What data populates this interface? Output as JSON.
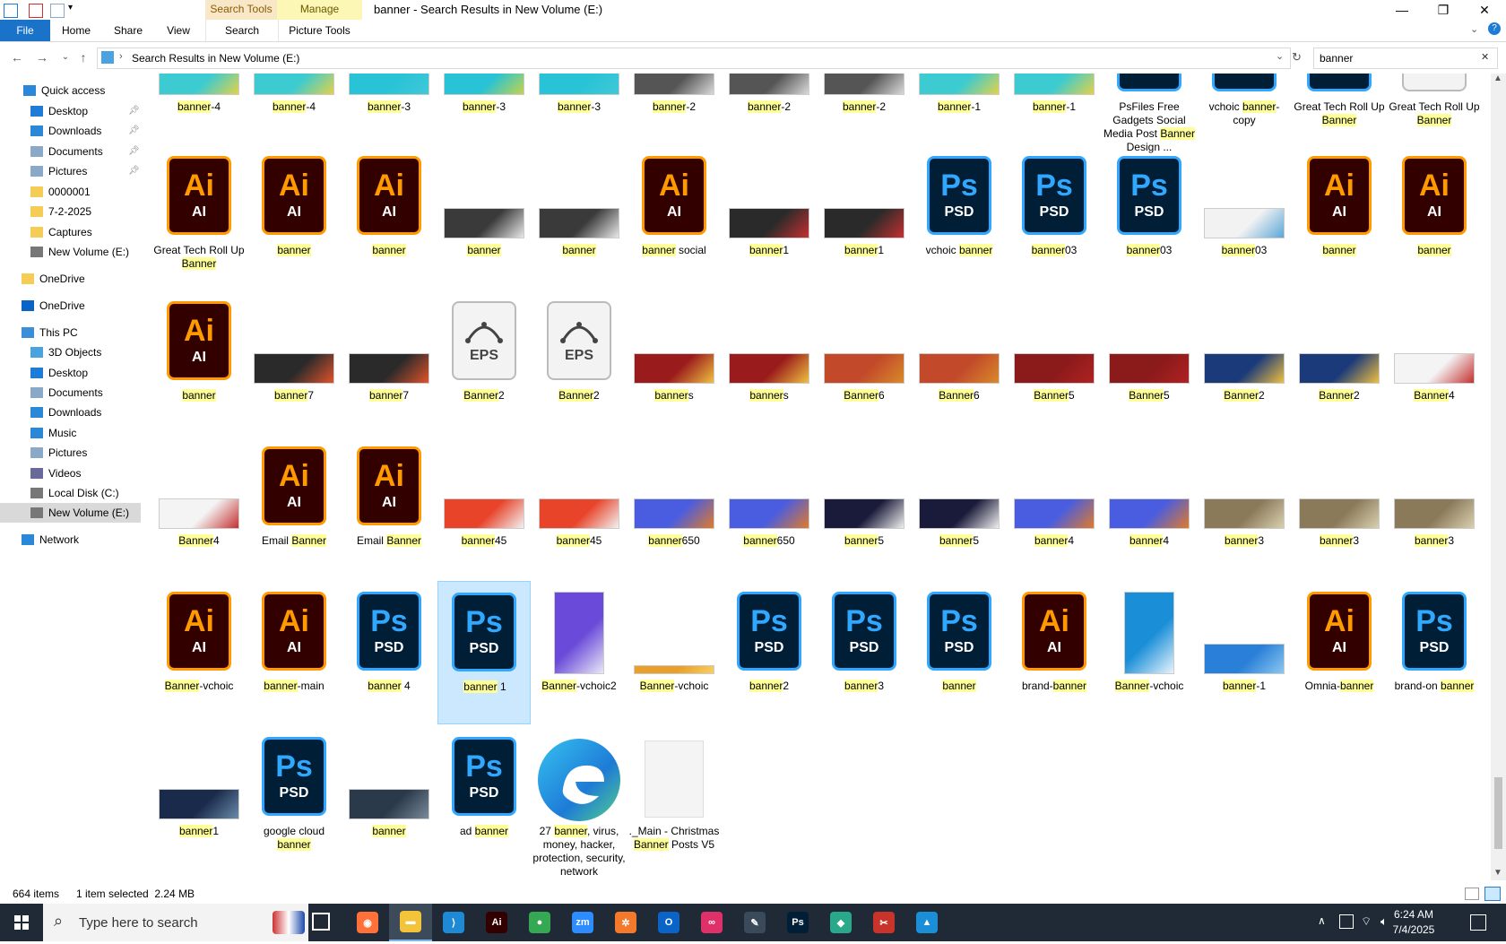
{
  "window": {
    "title": "banner - Search Results in New Volume (E:)",
    "ctx_search_tools": "Search Tools",
    "ctx_manage": "Manage",
    "tabs": [
      "File",
      "Home",
      "Share",
      "View",
      "Search",
      "Picture Tools"
    ],
    "minimize": "—",
    "maximize": "❐",
    "close": "✕"
  },
  "address": {
    "path": "Search Results in New Volume (E:)",
    "search_value": "banner",
    "clear_icon": "✕"
  },
  "sidebar": {
    "items": [
      {
        "label": "Quick access",
        "icon": "star-icon",
        "color": "#2b88d8"
      },
      {
        "label": "Desktop",
        "icon": "desktop-icon",
        "color": "#1e7bd6",
        "pinned": true
      },
      {
        "label": "Downloads",
        "icon": "download-icon",
        "color": "#2b88d8",
        "pinned": true
      },
      {
        "label": "Documents",
        "icon": "document-icon",
        "color": "#8aa8c8",
        "pinned": true
      },
      {
        "label": "Pictures",
        "icon": "pictures-icon",
        "color": "#8aa8c8",
        "pinned": true
      },
      {
        "label": "0000001",
        "icon": "folder-icon",
        "color": "#f5cd56"
      },
      {
        "label": "7-2-2025",
        "icon": "folder-icon",
        "color": "#f5cd56"
      },
      {
        "label": "Captures",
        "icon": "folder-icon",
        "color": "#f5cd56"
      },
      {
        "label": "New Volume (E:)",
        "icon": "drive-icon",
        "color": "#777"
      },
      {
        "label": "OneDrive",
        "icon": "folder-icon",
        "color": "#f5cd56"
      },
      {
        "label": "OneDrive",
        "icon": "cloud-icon",
        "color": "#0a64c8"
      },
      {
        "label": "This PC",
        "icon": "computer-icon",
        "color": "#3a8fd8"
      },
      {
        "label": "3D Objects",
        "icon": "cube-icon",
        "color": "#4aa3df"
      },
      {
        "label": "Desktop",
        "icon": "desktop-icon",
        "color": "#1e7bd6"
      },
      {
        "label": "Documents",
        "icon": "document-icon",
        "color": "#8aa8c8"
      },
      {
        "label": "Downloads",
        "icon": "download-icon",
        "color": "#2b88d8"
      },
      {
        "label": "Music",
        "icon": "music-icon",
        "color": "#2b88d8"
      },
      {
        "label": "Pictures",
        "icon": "pictures-icon",
        "color": "#8aa8c8"
      },
      {
        "label": "Videos",
        "icon": "video-icon",
        "color": "#6a6a9a"
      },
      {
        "label": "Local Disk (C:)",
        "icon": "drive-icon",
        "color": "#777"
      },
      {
        "label": "New Volume (E:)",
        "icon": "drive-icon",
        "color": "#777",
        "selected": true
      },
      {
        "label": "Network",
        "icon": "network-icon",
        "color": "#2b88d8"
      }
    ]
  },
  "files": [
    [
      {
        "pre": "",
        "hl": "banner",
        "post": "-4",
        "kind": "img",
        "c1": "#3ccbd0",
        "c2": "#e3d24a"
      },
      {
        "pre": "",
        "hl": "banner",
        "post": "-4",
        "kind": "img",
        "c1": "#3ccbd0",
        "c2": "#e3d24a"
      },
      {
        "pre": "",
        "hl": "banner",
        "post": "-3",
        "kind": "img",
        "c1": "#28c3d6",
        "c2": "#40c8d8"
      },
      {
        "pre": "",
        "hl": "banner",
        "post": "-3",
        "kind": "img",
        "c1": "#28c3d6",
        "c2": "#c4d44a"
      },
      {
        "pre": "",
        "hl": "banner",
        "post": "-3",
        "kind": "img",
        "c1": "#28c3d6",
        "c2": "#40c8d8"
      },
      {
        "pre": "",
        "hl": "banner",
        "post": "-2",
        "kind": "img",
        "c1": "#555",
        "c2": "#d9d9d9"
      },
      {
        "pre": "",
        "hl": "banner",
        "post": "-2",
        "kind": "img",
        "c1": "#555",
        "c2": "#d9d9d9"
      },
      {
        "pre": "",
        "hl": "banner",
        "post": "-2",
        "kind": "img",
        "c1": "#555",
        "c2": "#d9d9d9"
      },
      {
        "pre": "",
        "hl": "banner",
        "post": "-1",
        "kind": "img",
        "c1": "#3ccbd0",
        "c2": "#e3d24a"
      },
      {
        "pre": "",
        "hl": "banner",
        "post": "-1",
        "kind": "img",
        "c1": "#3ccbd0",
        "c2": "#e3d24a"
      },
      {
        "pre": "PsFiles Free Gadgets Social Media Post ",
        "hl": "Banner",
        "post": " Design ...",
        "kind": "psd"
      },
      {
        "pre": "vchoic ",
        "hl": "banner",
        "post": "-copy",
        "kind": "psd"
      },
      {
        "pre": "Great Tech Roll Up ",
        "hl": "Banner",
        "post": "",
        "kind": "psd"
      },
      {
        "pre": "Great Tech Roll Up ",
        "hl": "Banner",
        "post": "",
        "kind": "eps"
      }
    ],
    [
      {
        "pre": "Great Tech Roll Up ",
        "hl": "Banner",
        "post": "",
        "kind": "ai"
      },
      {
        "pre": "",
        "hl": "banner",
        "post": "",
        "kind": "ai"
      },
      {
        "pre": "",
        "hl": "banner",
        "post": "",
        "kind": "ai"
      },
      {
        "pre": "",
        "hl": "banner",
        "post": "",
        "kind": "img",
        "c1": "#3a3a3a",
        "c2": "#e8e8e8"
      },
      {
        "pre": "",
        "hl": "banner",
        "post": "",
        "kind": "img",
        "c1": "#3a3a3a",
        "c2": "#e8e8e8"
      },
      {
        "pre": "",
        "hl": "banner",
        "post": " social",
        "kind": "ai"
      },
      {
        "pre": "",
        "hl": "banner",
        "post": "1",
        "kind": "img",
        "c1": "#2a2a2a",
        "c2": "#c53030"
      },
      {
        "pre": "",
        "hl": "banner",
        "post": "1",
        "kind": "img",
        "c1": "#2a2a2a",
        "c2": "#c53030"
      },
      {
        "pre": "vchoic ",
        "hl": "banner",
        "post": "",
        "kind": "psd"
      },
      {
        "pre": "",
        "hl": "banner",
        "post": "03",
        "kind": "psd"
      },
      {
        "pre": "",
        "hl": "banner",
        "post": "03",
        "kind": "psd"
      },
      {
        "pre": "",
        "hl": "banner",
        "post": "03",
        "kind": "img",
        "c1": "#f2f2f2",
        "c2": "#5aa7d8"
      },
      {
        "pre": "",
        "hl": "banner",
        "post": "",
        "kind": "ai"
      },
      {
        "pre": "",
        "hl": "banner",
        "post": "",
        "kind": "ai"
      }
    ],
    [
      {
        "pre": "",
        "hl": "banner",
        "post": "",
        "kind": "ai"
      },
      {
        "pre": "",
        "hl": "banner",
        "post": "7",
        "kind": "img",
        "c1": "#2a2a2a",
        "c2": "#e0532a"
      },
      {
        "pre": "",
        "hl": "banner",
        "post": "7",
        "kind": "img",
        "c1": "#2a2a2a",
        "c2": "#e0532a"
      },
      {
        "pre": "",
        "hl": "Banner",
        "post": "2",
        "kind": "eps"
      },
      {
        "pre": "",
        "hl": "Banner",
        "post": "2",
        "kind": "eps"
      },
      {
        "pre": "",
        "hl": "banner",
        "post": "s",
        "kind": "img",
        "c1": "#9a1b1b",
        "c2": "#f0c040"
      },
      {
        "pre": "",
        "hl": "banner",
        "post": "s",
        "kind": "img",
        "c1": "#9a1b1b",
        "c2": "#f0c040"
      },
      {
        "pre": "",
        "hl": "Banner",
        "post": "6",
        "kind": "img",
        "c1": "#c24a2a",
        "c2": "#d98a2a"
      },
      {
        "pre": "",
        "hl": "Banner",
        "post": "6",
        "kind": "img",
        "c1": "#c24a2a",
        "c2": "#d98a2a"
      },
      {
        "pre": "",
        "hl": "Banner",
        "post": "5",
        "kind": "img",
        "c1": "#8b1a1a",
        "c2": "#b02222"
      },
      {
        "pre": "",
        "hl": "Banner",
        "post": "5",
        "kind": "img",
        "c1": "#8b1a1a",
        "c2": "#b02222"
      },
      {
        "pre": "",
        "hl": "Banner",
        "post": "2",
        "kind": "img",
        "c1": "#1b3a7a",
        "c2": "#f0c040"
      },
      {
        "pre": "",
        "hl": "Banner",
        "post": "2",
        "kind": "img",
        "c1": "#1b3a7a",
        "c2": "#f0c040"
      },
      {
        "pre": "",
        "hl": "Banner",
        "post": "4",
        "kind": "img",
        "c1": "#f4f4f4",
        "c2": "#c53030"
      }
    ],
    [
      {
        "pre": "",
        "hl": "Banner",
        "post": "4",
        "kind": "img",
        "c1": "#f4f4f4",
        "c2": "#c53030"
      },
      {
        "pre": "Email ",
        "hl": "Banner",
        "post": "",
        "kind": "ai"
      },
      {
        "pre": "Email ",
        "hl": "Banner",
        "post": "",
        "kind": "ai"
      },
      {
        "pre": "",
        "hl": "banner",
        "post": "45",
        "kind": "img",
        "c1": "#e8442a",
        "c2": "#f2f2f2"
      },
      {
        "pre": "",
        "hl": "banner",
        "post": "45",
        "kind": "img",
        "c1": "#e8442a",
        "c2": "#f2f2f2"
      },
      {
        "pre": "",
        "hl": "banner",
        "post": "650",
        "kind": "img",
        "c1": "#4a5de0",
        "c2": "#e07a2a"
      },
      {
        "pre": "",
        "hl": "banner",
        "post": "650",
        "kind": "img",
        "c1": "#4a5de0",
        "c2": "#e07a2a"
      },
      {
        "pre": "",
        "hl": "banner",
        "post": "5",
        "kind": "img",
        "c1": "#1a1a3a",
        "c2": "#f0f0f0"
      },
      {
        "pre": "",
        "hl": "banner",
        "post": "5",
        "kind": "img",
        "c1": "#1a1a3a",
        "c2": "#f0f0f0"
      },
      {
        "pre": "",
        "hl": "banner",
        "post": "4",
        "kind": "img",
        "c1": "#4a5de0",
        "c2": "#e07a2a"
      },
      {
        "pre": "",
        "hl": "banner",
        "post": "4",
        "kind": "img",
        "c1": "#4a5de0",
        "c2": "#e07a2a"
      },
      {
        "pre": "",
        "hl": "banner",
        "post": "3",
        "kind": "img",
        "c1": "#8a7a5a",
        "c2": "#d9d0b0"
      },
      {
        "pre": "",
        "hl": "banner",
        "post": "3",
        "kind": "img",
        "c1": "#8a7a5a",
        "c2": "#d9d0b0"
      },
      {
        "pre": "",
        "hl": "banner",
        "post": "3",
        "kind": "img",
        "c1": "#8a7a5a",
        "c2": "#d9d0b0"
      }
    ],
    [
      {
        "pre": "",
        "hl": "Banner",
        "post": "-vchoic",
        "kind": "ai"
      },
      {
        "pre": "",
        "hl": "banner",
        "post": "-main",
        "kind": "ai"
      },
      {
        "pre": "",
        "hl": "banner",
        "post": " 4",
        "kind": "psd"
      },
      {
        "pre": "",
        "hl": "banner",
        "post": " 1",
        "kind": "psd",
        "selected": true
      },
      {
        "pre": "",
        "hl": "Banner",
        "post": "-vchoic2",
        "kind": "img",
        "c1": "#6a4ad8",
        "c2": "#e8e8f8",
        "tall": true
      },
      {
        "pre": "",
        "hl": "Banner",
        "post": "-vchoic",
        "kind": "img",
        "c1": "#e8a02a",
        "c2": "#f8d060",
        "thin": true
      },
      {
        "pre": "",
        "hl": "banner",
        "post": "2",
        "kind": "psd"
      },
      {
        "pre": "",
        "hl": "banner",
        "post": "3",
        "kind": "psd"
      },
      {
        "pre": "",
        "hl": "banner",
        "post": "",
        "kind": "psd"
      },
      {
        "pre": "brand-",
        "hl": "banner",
        "post": "",
        "kind": "ai"
      },
      {
        "pre": "",
        "hl": "Banner",
        "post": "-vchoic",
        "kind": "img",
        "c1": "#1a8fd8",
        "c2": "#e8f4fc",
        "tall": true
      },
      {
        "pre": "",
        "hl": "banner",
        "post": "-1",
        "kind": "img",
        "c1": "#2a7fd8",
        "c2": "#8ac8f0"
      },
      {
        "pre": "Omnia-",
        "hl": "banner",
        "post": "",
        "kind": "ai"
      },
      {
        "pre": "brand-on ",
        "hl": "banner",
        "post": "",
        "kind": "psd"
      }
    ],
    [
      {
        "pre": "",
        "hl": "banner",
        "post": "1",
        "kind": "img",
        "c1": "#1a2a4a",
        "c2": "#6a8aaa"
      },
      {
        "pre": "google cloud ",
        "hl": "banner",
        "post": "",
        "kind": "psd"
      },
      {
        "pre": "",
        "hl": "banner",
        "post": "",
        "kind": "img",
        "c1": "#2a3a4a",
        "c2": "#7a8a9a"
      },
      {
        "pre": "ad ",
        "hl": "banner",
        "post": "",
        "kind": "psd"
      },
      {
        "pre": "27 ",
        "hl": "banner",
        "post": ", virus, money, hacker, protection, security, network",
        "kind": "edge"
      },
      {
        "pre": "._Main - Christmas ",
        "hl": "Banner",
        "post": " Posts V5",
        "kind": "blank"
      }
    ]
  ],
  "file_icons": {
    "ai_big": "Ai",
    "ai_small": "AI",
    "psd_big": "Ps",
    "psd_small": "PSD",
    "eps_small": "EPS"
  },
  "status": {
    "count": "664 items",
    "selection": "1 item selected  2.24 MB"
  },
  "taskbar": {
    "search_placeholder": "Type here to search",
    "time": "6:24 AM",
    "date": "7/4/2025",
    "apps": [
      {
        "name": "firefox",
        "bg": "#ff7139",
        "glyph": "◉"
      },
      {
        "name": "file-explorer",
        "bg": "#f3c33a",
        "glyph": "▬"
      },
      {
        "name": "vscode",
        "bg": "#1e8ad6",
        "glyph": "⟩"
      },
      {
        "name": "illustrator",
        "bg": "#330000",
        "glyph": "Ai"
      },
      {
        "name": "chrome",
        "bg": "#34a853",
        "glyph": "●"
      },
      {
        "name": "zoom",
        "bg": "#2d8cff",
        "glyph": "zm"
      },
      {
        "name": "blender",
        "bg": "#f5792a",
        "glyph": "✲"
      },
      {
        "name": "outlook",
        "bg": "#0a64c8",
        "glyph": "O"
      },
      {
        "name": "creative-cloud",
        "bg": "#e0306a",
        "glyph": "∞"
      },
      {
        "name": "pen-tool",
        "bg": "#3a4a5a",
        "glyph": "✎"
      },
      {
        "name": "photoshop",
        "bg": "#001e36",
        "glyph": "Ps"
      },
      {
        "name": "app-green",
        "bg": "#2aa88a",
        "glyph": "◆"
      },
      {
        "name": "app-tools",
        "bg": "#c8332a",
        "glyph": "✂"
      },
      {
        "name": "app-photos",
        "bg": "#1a8fd8",
        "glyph": "▲"
      }
    ]
  }
}
